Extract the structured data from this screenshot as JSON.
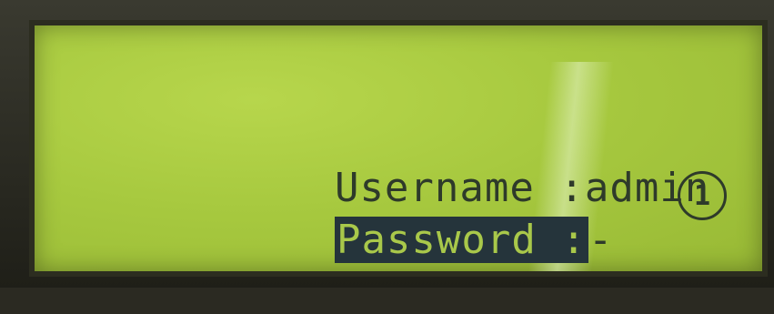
{
  "screen": {
    "username_label": "Username :",
    "username_value": "admin",
    "password_label": "Password :",
    "password_value": "-",
    "status_icon_text": "1"
  }
}
